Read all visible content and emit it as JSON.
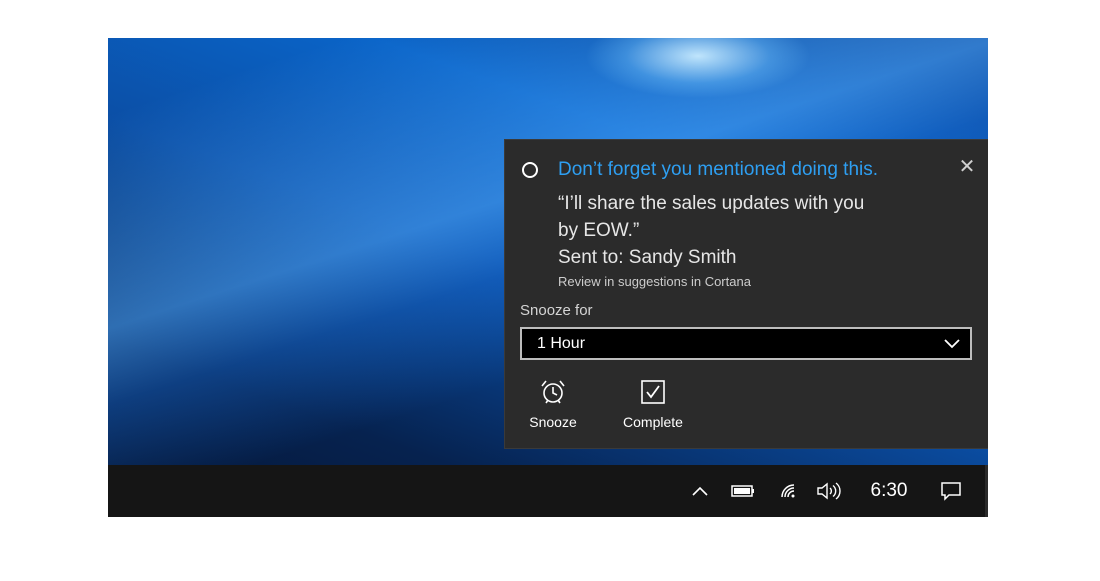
{
  "notification": {
    "title": "Don’t forget you mentioned doing this.",
    "quote": "“I’ll share the sales updates with you by EOW.”",
    "sent_to": "Sent to: Sandy Smith",
    "review_link": "Review in suggestions in Cortana",
    "snooze_label": "Snooze for",
    "snooze_selected": "1 Hour",
    "actions": [
      {
        "label": "Snooze",
        "icon": "alarm-clock-icon"
      },
      {
        "label": "Complete",
        "icon": "checkbox-icon"
      }
    ],
    "close_icon": "close-icon",
    "title_color": "#2e9ff2"
  },
  "taskbar": {
    "clock": "6:30",
    "tray_icons": [
      "chevron-up-icon",
      "battery-icon",
      "wifi-icon",
      "volume-icon",
      "action-center-icon"
    ]
  }
}
